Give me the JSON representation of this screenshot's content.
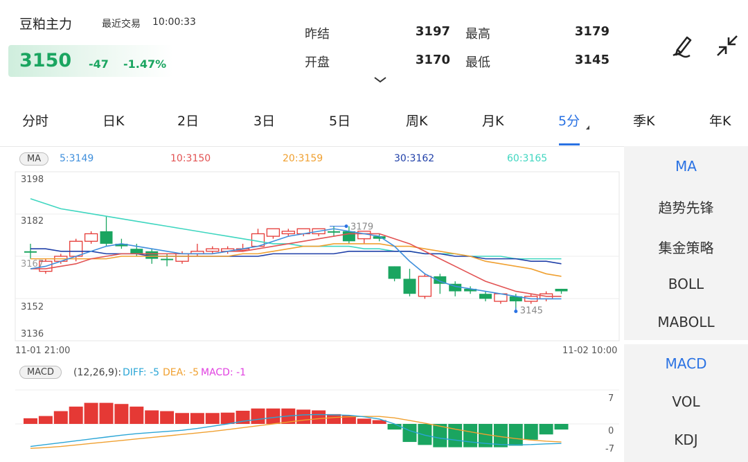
{
  "header": {
    "symbol": "豆粕主力",
    "recent_label": "最近交易",
    "recent_time": "10:00:33",
    "price": "3150",
    "change": "-47",
    "change_pct": "-1.47%",
    "stats": [
      {
        "label": "昨结",
        "value": "3197"
      },
      {
        "label": "最高",
        "value": "3179"
      },
      {
        "label": "开盘",
        "value": "3170"
      },
      {
        "label": "最低",
        "value": "3145"
      }
    ],
    "icons": {
      "draw": "pen-draw-icon",
      "collapse": "collapse-arrows-icon",
      "expand": "chevron-down-icon"
    }
  },
  "tabs": [
    "分时",
    "日K",
    "2日",
    "3日",
    "5日",
    "周K",
    "月K",
    "5分",
    "季K",
    "年K"
  ],
  "active_tab": "5分",
  "ma": {
    "label": "MA",
    "values": [
      {
        "text": "5:3149",
        "color": "#3f8fdc"
      },
      {
        "text": "10:3150",
        "color": "#e25252"
      },
      {
        "text": "20:3159",
        "color": "#f0a030"
      },
      {
        "text": "30:3162",
        "color": "#1f3fa8"
      },
      {
        "text": "60:3165",
        "color": "#3fd6c0"
      }
    ]
  },
  "price_axis": {
    "ticks": [
      "3198",
      "3182",
      "3167",
      "3152",
      "3136"
    ],
    "x_start": "11-01 21:00",
    "x_end": "11-02 10:00"
  },
  "annotations": {
    "high": "3179",
    "low": "3145"
  },
  "macd": {
    "label": "MACD",
    "params": "(12,26,9):",
    "diff": "DIFF: -5",
    "dea": "DEA: -5",
    "macd": "MACD: -1",
    "colors": {
      "diff": "#2aa5d6",
      "dea": "#f0a030",
      "macd": "#e040e0"
    },
    "ticks": [
      "7",
      "0",
      "-7"
    ]
  },
  "side_main": [
    "MA",
    "趋势先锋",
    "集金策略",
    "BOLL",
    "MABOLL"
  ],
  "side_sub": [
    "MACD",
    "VOL",
    "KDJ"
  ],
  "colors": {
    "up": "#e53935",
    "down": "#1aa560",
    "accent": "#2a72e3"
  },
  "chart_data": {
    "type": "candlestick",
    "ylim": [
      3136,
      3198
    ],
    "candles": [
      {
        "o": 3169,
        "c": 3169,
        "h": 3172,
        "l": 3166,
        "dir": "down"
      },
      {
        "o": 3161,
        "c": 3165,
        "h": 3166,
        "l": 3160,
        "dir": "up"
      },
      {
        "o": 3165,
        "c": 3167,
        "h": 3168,
        "l": 3164,
        "dir": "up"
      },
      {
        "o": 3167,
        "c": 3173,
        "h": 3174,
        "l": 3165,
        "dir": "up"
      },
      {
        "o": 3173,
        "c": 3176,
        "h": 3177,
        "l": 3172,
        "dir": "up"
      },
      {
        "o": 3177,
        "c": 3172,
        "h": 3183,
        "l": 3171,
        "dir": "down"
      },
      {
        "o": 3172,
        "c": 3171,
        "h": 3174,
        "l": 3170,
        "dir": "down"
      },
      {
        "o": 3170,
        "c": 3168,
        "h": 3172,
        "l": 3167,
        "dir": "down"
      },
      {
        "o": 3169,
        "c": 3166,
        "h": 3170,
        "l": 3164,
        "dir": "down"
      },
      {
        "o": 3166,
        "c": 3166,
        "h": 3168,
        "l": 3163,
        "dir": "down"
      },
      {
        "o": 3165,
        "c": 3168,
        "h": 3169,
        "l": 3164,
        "dir": "up"
      },
      {
        "o": 3168,
        "c": 3169,
        "h": 3172,
        "l": 3167,
        "dir": "up"
      },
      {
        "o": 3169,
        "c": 3170,
        "h": 3171,
        "l": 3168,
        "dir": "up"
      },
      {
        "o": 3169,
        "c": 3170,
        "h": 3171,
        "l": 3168,
        "dir": "up"
      },
      {
        "o": 3170,
        "c": 3170,
        "h": 3172,
        "l": 3169,
        "dir": "up"
      },
      {
        "o": 3171,
        "c": 3176,
        "h": 3178,
        "l": 3171,
        "dir": "up"
      },
      {
        "o": 3175,
        "c": 3178,
        "h": 3178,
        "l": 3174,
        "dir": "up"
      },
      {
        "o": 3176,
        "c": 3177,
        "h": 3178,
        "l": 3175,
        "dir": "up"
      },
      {
        "o": 3176,
        "c": 3178,
        "h": 3178,
        "l": 3175,
        "dir": "up"
      },
      {
        "o": 3176,
        "c": 3178,
        "h": 3178,
        "l": 3175,
        "dir": "up"
      },
      {
        "o": 3177,
        "c": 3177,
        "h": 3179,
        "l": 3175,
        "dir": "down"
      },
      {
        "o": 3177,
        "c": 3173,
        "h": 3179,
        "l": 3172,
        "dir": "down"
      },
      {
        "o": 3174,
        "c": 3177,
        "h": 3177,
        "l": 3172,
        "dir": "up"
      },
      {
        "o": 3174,
        "c": 3175,
        "h": 3176,
        "l": 3173,
        "dir": "down"
      },
      {
        "o": 3163,
        "c": 3158,
        "h": 3163,
        "l": 3157,
        "dir": "down"
      },
      {
        "o": 3158,
        "c": 3152,
        "h": 3162,
        "l": 3151,
        "dir": "down"
      },
      {
        "o": 3151,
        "c": 3159,
        "h": 3160,
        "l": 3150,
        "dir": "up"
      },
      {
        "o": 3159,
        "c": 3156,
        "h": 3160,
        "l": 3152,
        "dir": "down"
      },
      {
        "o": 3156,
        "c": 3153,
        "h": 3157,
        "l": 3151,
        "dir": "down"
      },
      {
        "o": 3154,
        "c": 3153,
        "h": 3155,
        "l": 3152,
        "dir": "down"
      },
      {
        "o": 3152,
        "c": 3150,
        "h": 3153,
        "l": 3149,
        "dir": "down"
      },
      {
        "o": 3149,
        "c": 3152,
        "h": 3152,
        "l": 3148,
        "dir": "up"
      },
      {
        "o": 3151,
        "c": 3149,
        "h": 3152,
        "l": 3145,
        "dir": "down"
      },
      {
        "o": 3149,
        "c": 3151,
        "h": 3152,
        "l": 3148,
        "dir": "up"
      },
      {
        "o": 3150,
        "c": 3152,
        "h": 3153,
        "l": 3149,
        "dir": "up"
      },
      {
        "o": 3153,
        "c": 3154,
        "h": 3154,
        "l": 3152,
        "dir": "down"
      }
    ],
    "ma5": [
      3162,
      3163,
      3165,
      3167,
      3169,
      3171,
      3172,
      3171,
      3170,
      3169,
      3168,
      3168,
      3168,
      3169,
      3170,
      3171,
      3173,
      3175,
      3176,
      3177,
      3178,
      3177,
      3176,
      3175,
      3171,
      3165,
      3160,
      3157,
      3155,
      3154,
      3153,
      3152,
      3151,
      3150,
      3150,
      3150
    ],
    "ma10": [
      3162,
      3162,
      3163,
      3164,
      3166,
      3167,
      3168,
      3168,
      3168,
      3168,
      3168,
      3168,
      3168,
      3169,
      3169,
      3170,
      3171,
      3172,
      3173,
      3174,
      3175,
      3176,
      3176,
      3176,
      3174,
      3172,
      3169,
      3166,
      3163,
      3160,
      3157,
      3155,
      3153,
      3152,
      3151,
      3151
    ],
    "ma20": [
      3166,
      3166,
      3166,
      3166,
      3166,
      3166,
      3167,
      3167,
      3167,
      3167,
      3167,
      3167,
      3167,
      3167,
      3168,
      3168,
      3169,
      3170,
      3171,
      3171,
      3172,
      3172,
      3172,
      3172,
      3171,
      3171,
      3170,
      3169,
      3168,
      3167,
      3165,
      3164,
      3163,
      3162,
      3160,
      3159
    ],
    "ma30": [
      3170,
      3170,
      3169,
      3169,
      3169,
      3168,
      3168,
      3168,
      3167,
      3167,
      3167,
      3167,
      3167,
      3167,
      3167,
      3167,
      3168,
      3168,
      3168,
      3168,
      3168,
      3169,
      3169,
      3169,
      3169,
      3169,
      3168,
      3168,
      3167,
      3167,
      3166,
      3166,
      3166,
      3165,
      3165,
      3164
    ],
    "ma60": [
      3190,
      3188,
      3186,
      3185,
      3184,
      3183,
      3182,
      3181,
      3180,
      3179,
      3178,
      3177,
      3176,
      3175,
      3174,
      3173,
      3172,
      3172,
      3171,
      3171,
      3171,
      3171,
      3170,
      3170,
      3169,
      3169,
      3168,
      3168,
      3168,
      3167,
      3167,
      3167,
      3166,
      3166,
      3166,
      3166
    ],
    "macd_hist": [
      1.5,
      2.1,
      3.4,
      4.6,
      5.6,
      5.6,
      5.3,
      4.6,
      3.6,
      3.4,
      2.9,
      2.9,
      2.9,
      3.0,
      3.5,
      4.1,
      4.1,
      4.1,
      3.8,
      3.6,
      2.6,
      2.2,
      1.4,
      1.0,
      -1.5,
      -4.8,
      -5.6,
      -6.2,
      -6.2,
      -6.2,
      -6.2,
      -6.2,
      -5.8,
      -4.2,
      -2.8,
      -1.5
    ],
    "diff": [
      -6.0,
      -5.5,
      -5.0,
      -4.5,
      -4.0,
      -3.5,
      -3.0,
      -2.6,
      -2.3,
      -2.0,
      -1.7,
      -1.2,
      -0.6,
      0.0,
      0.7,
      1.2,
      1.7,
      2.1,
      2.4,
      2.5,
      2.4,
      2.3,
      1.9,
      1.3,
      0.0,
      -1.8,
      -3.0,
      -3.8,
      -4.3,
      -4.8,
      -5.2,
      -5.5,
      -5.6,
      -5.5,
      -5.3,
      -5.2
    ],
    "dea": [
      -6.5,
      -6.3,
      -6.0,
      -5.6,
      -5.2,
      -4.8,
      -4.4,
      -4.0,
      -3.6,
      -3.2,
      -2.8,
      -2.4,
      -2.0,
      -1.5,
      -1.0,
      -0.5,
      0.0,
      0.5,
      1.0,
      1.4,
      1.7,
      1.9,
      2.0,
      2.0,
      1.6,
      0.9,
      0.2,
      -0.6,
      -1.4,
      -2.1,
      -2.8,
      -3.4,
      -3.9,
      -4.3,
      -4.6,
      -4.8
    ],
    "macd_ylim": [
      -7,
      7
    ]
  }
}
